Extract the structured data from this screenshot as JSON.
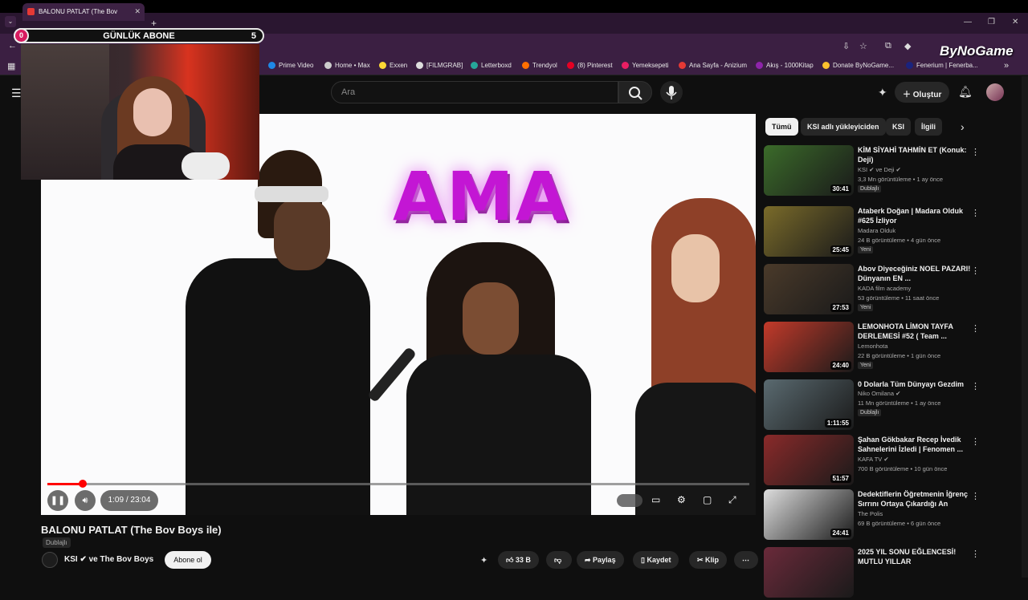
{
  "browser": {
    "tab_title": "BALONU PATLAT (The Bov",
    "bookmarks": [
      {
        "label": "Prime Video",
        "color": "#1e88e5"
      },
      {
        "label": "Home • Max",
        "color": "#cccccc"
      },
      {
        "label": "Exxen",
        "color": "#fdd835"
      },
      {
        "label": "[FILMGRAB]",
        "color": "#dddddd"
      },
      {
        "label": "Letterboxd",
        "color": "#26a69a"
      },
      {
        "label": "Trendyol",
        "color": "#ff6f00"
      },
      {
        "label": "(8) Pinterest",
        "color": "#e60023"
      },
      {
        "label": "Yemeksepeti",
        "color": "#e91e63"
      },
      {
        "label": "Ana Sayfa - Anizium",
        "color": "#e53935"
      },
      {
        "label": "Akış - 1000Kitap",
        "color": "#8e24aa"
      },
      {
        "label": "Donate ByNoGame...",
        "color": "#fbc02d"
      },
      {
        "label": "Fenerium | Fenerba...",
        "color": "#1a237e"
      }
    ]
  },
  "overlay": {
    "sub_label": "GÜNLÜK ABONE",
    "sub_left": "0",
    "sub_count": "5",
    "watermark": "ByNoGame"
  },
  "header": {
    "search_placeholder": "Ara",
    "create_label": "Oluştur"
  },
  "player": {
    "sign_text": "AMA",
    "time": "1:09 / 23:04",
    "progress": 0.05
  },
  "video": {
    "title": "BALONU PATLAT (The Bov Boys ile)",
    "dubbed": "Dublajlı",
    "channel": "KSI",
    "channel_suffix": "ve The Bov Boys",
    "subscribe": "Abone ol",
    "likes": "33 B",
    "share": "Paylaş",
    "save": "Kaydet",
    "clip": "Klip"
  },
  "chips": [
    "Tümü",
    "KSI adlı yükleyiciden",
    "KSI",
    "İlgili"
  ],
  "recommendations": [
    {
      "title": "KİM SİYAHİ TAHMİN ET (Konuk: Deji)",
      "channel": "KSI ✔ ve Deji ✔",
      "meta": "3,3 Mn görüntüleme • 1 ay önce",
      "badge": "Dublajlı",
      "duration": "30:41",
      "thumb": "#3b6b2a"
    },
    {
      "title": "Ataberk Doğan | Madara Olduk #625 İzliyor",
      "channel": "Madara Olduk",
      "meta": "24 B görüntüleme • 4 gün önce",
      "badge": "Yeni",
      "duration": "25:45",
      "thumb": "#7a6b2a"
    },
    {
      "title": "Abov Diyeceğiniz NOEL PAZARI! Dünyanın EN ...",
      "channel": "KADA film academy",
      "meta": "53 görüntüleme • 11 saat önce",
      "badge": "Yeni",
      "duration": "27:53",
      "thumb": "#4a3a2a"
    },
    {
      "title": "LEMONHOTA LİMON TAYFA DERLEMESİ #52 ( Team ...",
      "channel": "Lemonhota",
      "meta": "22 B görüntüleme • 1 gün önce",
      "badge": "Yeni",
      "duration": "24:40",
      "thumb": "#c33a2a"
    },
    {
      "title": "0 Dolarla Tüm Dünyayı Gezdim",
      "channel": "Niko Omilana ✔",
      "meta": "11 Mn görüntüleme • 1 ay önce",
      "badge": "Dublajlı",
      "duration": "1:11:55",
      "thumb": "#5a6a70"
    },
    {
      "title": "Şahan Gökbakar Recep İvedik Sahnelerini İzledi | Fenomen ...",
      "channel": "KAFA TV ✔",
      "meta": "700 B görüntüleme • 10 gün önce",
      "badge": "",
      "duration": "51:57",
      "thumb": "#8a2a2a"
    },
    {
      "title": "Dedektiflerin Öğretmenin İğrenç Sırrını Ortaya Çıkardığı An",
      "channel": "The Polis",
      "meta": "69 B görüntüleme • 6 gün önce",
      "badge": "",
      "duration": "24:41",
      "thumb": "#dddddd"
    },
    {
      "title": "2025 YIL SONU EĞLENCESİ! MUTLU YILLAR",
      "channel": "",
      "meta": "",
      "badge": "",
      "duration": "",
      "thumb": "#6a2a3a"
    }
  ]
}
